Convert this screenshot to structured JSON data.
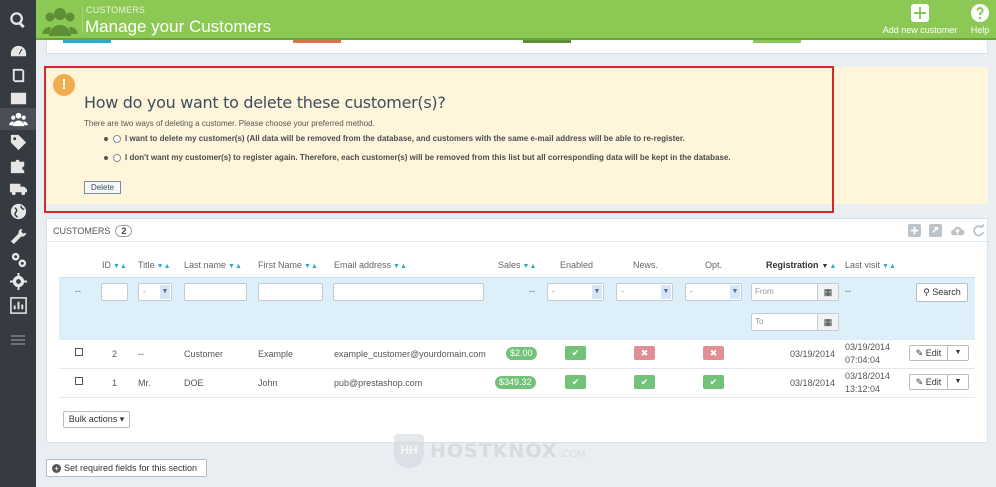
{
  "header": {
    "breadcrumb": "CUSTOMERS",
    "title": "Manage your Customers",
    "add_label": "Add new customer",
    "help_label": "Help",
    "color": "#8bc954"
  },
  "sidebar": {
    "items": [
      "search-icon",
      "dashboard-icon",
      "catalog-icon",
      "orders-icon",
      "customers-icon",
      "price-rules-icon",
      "modules-icon",
      "shipping-icon",
      "localization-icon",
      "preferences-icon",
      "advanced-icon",
      "administration-icon",
      "stats-icon"
    ]
  },
  "warning": {
    "title": "How do you want to delete these customer(s)?",
    "description": "There are two ways of deleting a customer. Please choose your preferred method.",
    "option1": "I want to delete my customer(s) (All data will be removed from the database, and customers with the same e-mail address will be able to re-register.",
    "option2": "I don't want my customer(s) to register again. Therefore, each customer(s) will be removed from this list but all corresponding data will be kept in the database.",
    "delete_label": "Delete",
    "icon": "!"
  },
  "customers": {
    "heading": "CUSTOMERS",
    "count": "2",
    "columns": {
      "id": "ID",
      "title": "Title",
      "last_name": "Last name",
      "first_name": "First Name",
      "email": "Email address",
      "sales": "Sales",
      "enabled": "Enabled",
      "news": "News.",
      "opt": "Opt.",
      "registration": "Registration",
      "last_visit": "Last visit"
    },
    "sort_arrows": "▼▲",
    "sort_arrow_desc": "▼",
    "sort_arrow_asc": "▲",
    "filters": {
      "dash": "--",
      "select_value": "-",
      "from_placeholder": "From",
      "to_placeholder": "To",
      "search_label": "Search"
    },
    "rows": [
      {
        "id": "2",
        "title": "--",
        "last_name": "Customer",
        "first_name": "Example",
        "email": "example_customer@yourdomain.com",
        "sales": "$2.00",
        "enabled": true,
        "news": false,
        "opt": false,
        "registration": "03/19/2014",
        "last_visit_date": "03/19/2014",
        "last_visit_time": "07:04:04",
        "edit_label": "Edit"
      },
      {
        "id": "1",
        "title": "Mr.",
        "last_name": "DOE",
        "first_name": "John",
        "email": "pub@prestashop.com",
        "sales": "$349.32",
        "enabled": true,
        "news": true,
        "opt": true,
        "registration": "03/18/2014",
        "last_visit_date": "03/18/2014",
        "last_visit_time": "13:12:04",
        "edit_label": "Edit"
      }
    ],
    "bulk_label": "Bulk actions"
  },
  "required_fields_label": "Set required fields for this section",
  "watermark": {
    "text": "HOSTKNOX",
    "sub": ".COM",
    "logo": "HH"
  }
}
